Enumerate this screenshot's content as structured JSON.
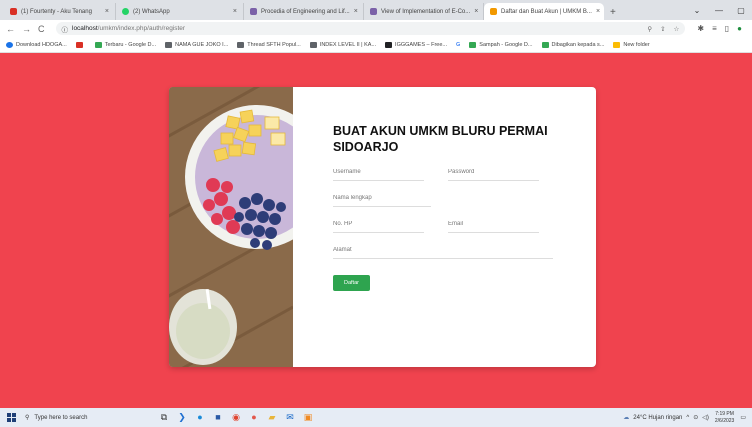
{
  "browser": {
    "tabs": [
      {
        "label": "(1) Fourtenty - Aku Tenang",
        "color": "#d93025"
      },
      {
        "label": "(2) WhatsApp",
        "color": "#25d366"
      },
      {
        "label": "Procedia of Engineering and Lif...",
        "color": "#7b61a8"
      },
      {
        "label": "View of Implementation of E-Co...",
        "color": "#7b61a8"
      },
      {
        "label": "Daftar dan Buat Akun | UMKM B...",
        "color": "#f29900"
      }
    ],
    "url_host": "localhost",
    "url_path": "/umkm/index.php/auth/register",
    "bookmarks": [
      {
        "label": "Download HDOGA...",
        "color": "#1a73e8"
      },
      {
        "label": "",
        "color": "#d93025"
      },
      {
        "label": "Terbaru - Google D...",
        "color": "#34a853"
      },
      {
        "label": "NAMA GUE JOKO I...",
        "color": "#5f6368"
      },
      {
        "label": "Thread SFTH Popul...",
        "color": "#5f6368"
      },
      {
        "label": "INDEX LEVEL II | KA...",
        "color": "#5f6368"
      },
      {
        "label": "IGGGAMES – Free...",
        "color": "#202124"
      },
      {
        "label": "G",
        "color": "#4285f4"
      },
      {
        "label": "Sampah - Google D...",
        "color": "#34a853"
      },
      {
        "label": "Dibagikan kepada s...",
        "color": "#34a853"
      },
      {
        "label": "New folder",
        "color": "#fbbc04"
      }
    ]
  },
  "form": {
    "title": "BUAT AKUN UMKM BLURU PERMAI SIDOARJO",
    "username_placeholder": "Username",
    "password_placeholder": "Password",
    "fullname_placeholder": "Nama lengkap",
    "phone_placeholder": "No. HP",
    "email_placeholder": "Email",
    "address_placeholder": "Alamat",
    "submit_label": "Daftar",
    "submit_color": "#2ea44f"
  },
  "page": {
    "background_color": "#f0434e"
  },
  "taskbar": {
    "search_placeholder": "Type here to search",
    "weather": "24°C  Hujan ringan",
    "time": "7:19 PM",
    "date": "2/6/2023"
  }
}
